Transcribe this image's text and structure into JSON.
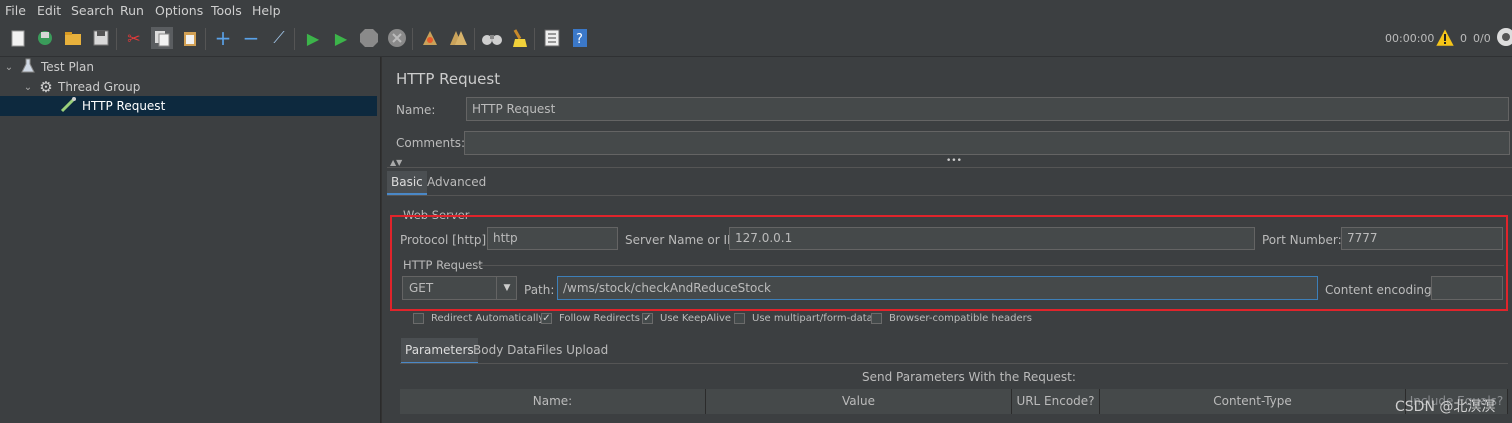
{
  "menu": {
    "file": "File",
    "edit": "Edit",
    "search": "Search",
    "run": "Run",
    "options": "Options",
    "tools": "Tools",
    "help": "Help"
  },
  "status": {
    "timer": "00:00:00",
    "warnings": "0",
    "threads": "0/0"
  },
  "tree": {
    "items": [
      {
        "label": "Test Plan"
      },
      {
        "label": "Thread Group"
      },
      {
        "label": "HTTP Request"
      }
    ]
  },
  "panel": {
    "title": "HTTP Request",
    "name_label": "Name:",
    "name_value": "HTTP Request",
    "comments_label": "Comments:",
    "comments_value": "",
    "collapse_dots": "•••",
    "tabs": [
      "Basic",
      "Advanced"
    ]
  },
  "web_server": {
    "legend": "Web Server",
    "protocol_label": "Protocol [http]:",
    "protocol_value": "http",
    "server_label": "Server Name or IP:",
    "server_value": "127.0.0.1",
    "port_label": "Port Number:",
    "port_value": "7777"
  },
  "http_request": {
    "legend": "HTTP Request",
    "method": "GET",
    "path_label": "Path:",
    "path_value": "/wms/stock/checkAndReduceStock",
    "encoding_label": "Content encoding:",
    "encoding_value": ""
  },
  "options": [
    {
      "label": "Redirect Automatically",
      "checked": false
    },
    {
      "label": "Follow Redirects",
      "checked": true
    },
    {
      "label": "Use KeepAlive",
      "checked": true
    },
    {
      "label": "Use multipart/form-data",
      "checked": false
    },
    {
      "label": "Browser-compatible headers",
      "checked": false
    }
  ],
  "params": {
    "tabs": [
      "Parameters",
      "Body Data",
      "Files Upload"
    ],
    "caption": "Send Parameters With the Request:",
    "columns": [
      "Name:",
      "Value",
      "URL Encode?",
      "Content-Type",
      "Include Equals?"
    ]
  },
  "watermark": "CSDN @北溟溟",
  "colors": {
    "background": "#3c3f41",
    "selection": "#0d293e",
    "highlight_box": "#e0242b",
    "focus": "#3d7fb8"
  }
}
